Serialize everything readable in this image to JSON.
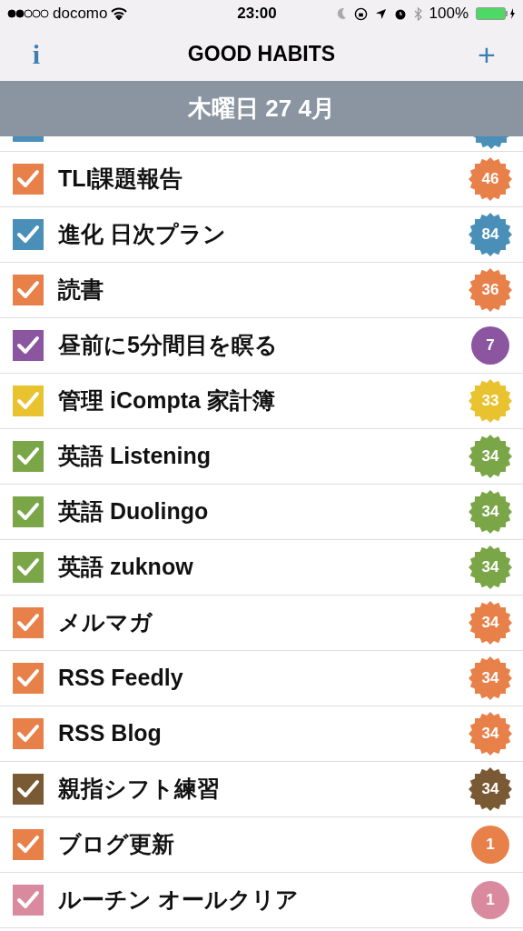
{
  "status_bar": {
    "carrier": "docomo",
    "time": "23:00",
    "battery": "100%"
  },
  "nav": {
    "info": "i",
    "title": "GOOD HABITS",
    "add": "+"
  },
  "date_header": "木曜日 27 4月",
  "partial_row": {
    "checked": true,
    "color": "#4a8fb8",
    "kind": "star"
  },
  "habits": [
    {
      "label": "TLI課題報告",
      "checked": true,
      "color": "#e8804a",
      "count": "46",
      "kind": "star"
    },
    {
      "label": "進化 日次プラン",
      "checked": true,
      "color": "#4a8fb8",
      "count": "84",
      "kind": "star"
    },
    {
      "label": "読書",
      "checked": true,
      "color": "#e8804a",
      "count": "36",
      "kind": "star"
    },
    {
      "label": "昼前に5分間目を瞑る",
      "checked": true,
      "color": "#8b55a0",
      "count": "7",
      "kind": "circle"
    },
    {
      "label": "管理 iCompta 家計簿",
      "checked": true,
      "color": "#e9c230",
      "count": "33",
      "kind": "star"
    },
    {
      "label": "英語 Listening",
      "checked": true,
      "color": "#7aa648",
      "count": "34",
      "kind": "star"
    },
    {
      "label": "英語 Duolingo",
      "checked": true,
      "color": "#7aa648",
      "count": "34",
      "kind": "star"
    },
    {
      "label": "英語 zuknow",
      "checked": true,
      "color": "#7aa648",
      "count": "34",
      "kind": "star"
    },
    {
      "label": "メルマガ",
      "checked": true,
      "color": "#e8804a",
      "count": "34",
      "kind": "star"
    },
    {
      "label": "RSS Feedly",
      "checked": true,
      "color": "#e8804a",
      "count": "34",
      "kind": "star"
    },
    {
      "label": "RSS Blog",
      "checked": true,
      "color": "#e8804a",
      "count": "34",
      "kind": "star"
    },
    {
      "label": "親指シフト練習",
      "checked": true,
      "color": "#7a5a34",
      "count": "34",
      "kind": "star"
    },
    {
      "label": "ブログ更新",
      "checked": true,
      "color": "#e8804a",
      "count": "1",
      "kind": "circle"
    },
    {
      "label": "ルーチン オールクリア",
      "checked": true,
      "color": "#d98a9e",
      "count": "1",
      "kind": "circle"
    }
  ]
}
